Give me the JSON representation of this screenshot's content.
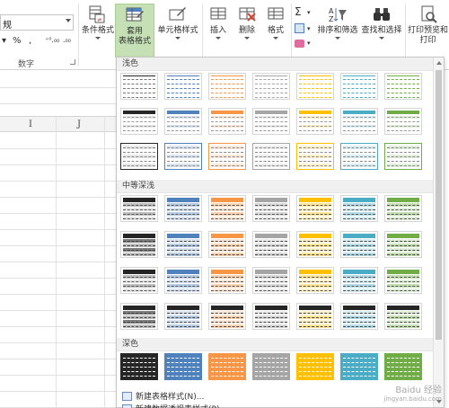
{
  "number_group": {
    "format_value": "规",
    "percent": "%",
    "comma": ",",
    "inc_decimal": "⁺⁰.₀₀",
    "dec_decimal": ".₀₀",
    "label": "数字"
  },
  "styles_group": {
    "conditional_format": "条件格式",
    "format_as_table_line1": "套用",
    "format_as_table_line2": "表格格式",
    "cell_styles": "单元格样式"
  },
  "cells_group": {
    "insert": "插入",
    "delete": "删除",
    "format": "格式"
  },
  "editing_group": {
    "sigma": "Σ",
    "sort_filter": "排序和筛选",
    "find_select": "查找和选择"
  },
  "print_group": {
    "print_preview_line1": "打印预览和",
    "print_preview_line2": "打印"
  },
  "sheet": {
    "col_i": "I",
    "col_j": "J"
  },
  "gallery": {
    "section_light": "浅色",
    "section_medium": "中等深浅",
    "section_dark": "深色",
    "new_style": "新建表格样式(N)...",
    "new_pivot_style": "新建数据透视表样式(P)..."
  },
  "watermark": {
    "text": "Baidu 经验",
    "sub": "jingyan.baidu.com"
  },
  "colors": {
    "accent_active": "#c5e0b4",
    "black": "#262626",
    "blue": "#4f81bd",
    "orange": "#f79646",
    "gray": "#a5a5a5",
    "gold": "#ffc000",
    "steel": "#4bacc6",
    "green": "#70ad47"
  }
}
